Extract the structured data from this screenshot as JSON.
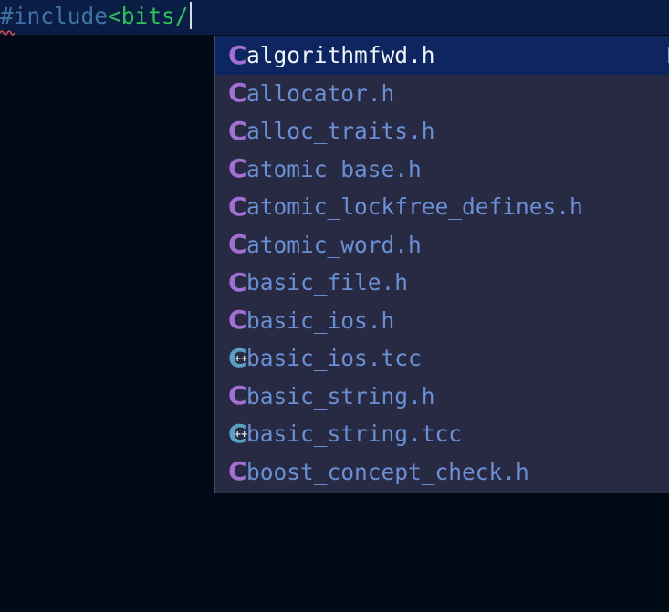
{
  "editor": {
    "directive": "#include",
    "path_typed": "<bits/",
    "background": "#010b17",
    "line_highlight": "#0a1e45",
    "error_color": "#e04a4a"
  },
  "suggestions": {
    "selected_index": 0,
    "items": [
      {
        "label": "algorithmfwd.h",
        "kind": "c-file-icon"
      },
      {
        "label": "allocator.h",
        "kind": "c-file-icon"
      },
      {
        "label": "alloc_traits.h",
        "kind": "c-file-icon"
      },
      {
        "label": "atomic_base.h",
        "kind": "c-file-icon"
      },
      {
        "label": "atomic_lockfree_defines.h",
        "kind": "c-file-icon"
      },
      {
        "label": "atomic_word.h",
        "kind": "c-file-icon"
      },
      {
        "label": "basic_file.h",
        "kind": "c-file-icon"
      },
      {
        "label": "basic_ios.h",
        "kind": "c-file-icon"
      },
      {
        "label": "basic_ios.tcc",
        "kind": "cpp-file-icon"
      },
      {
        "label": "basic_string.h",
        "kind": "c-file-icon"
      },
      {
        "label": "basic_string.tcc",
        "kind": "cpp-file-icon"
      },
      {
        "label": "boost_concept_check.h",
        "kind": "c-file-icon"
      }
    ]
  }
}
